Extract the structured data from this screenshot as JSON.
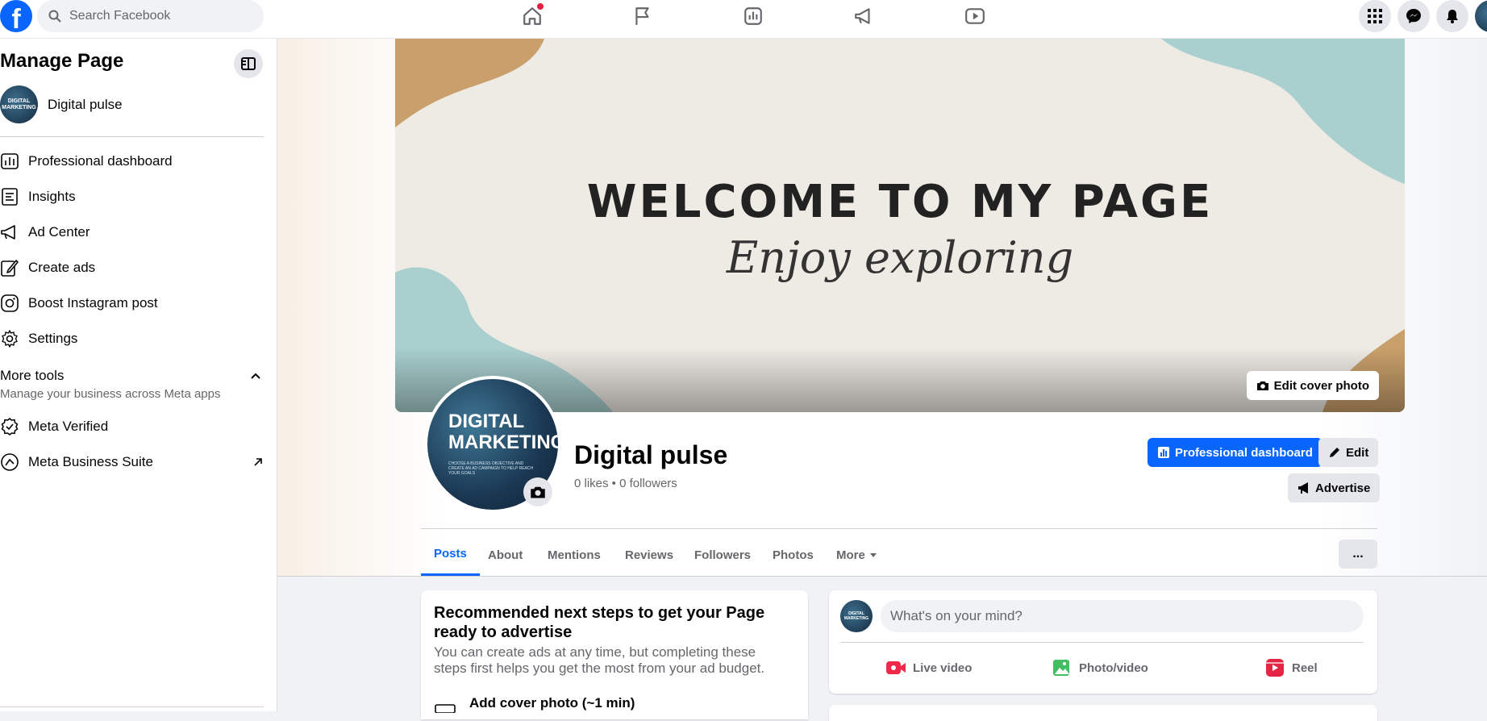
{
  "topbar": {
    "logo": "f",
    "search_placeholder": "Search Facebook",
    "nav": [
      "home-icon",
      "flag-icon",
      "insights-icon",
      "megaphone-icon",
      "video-icon"
    ],
    "right": [
      "menu-grid-icon",
      "messenger-icon",
      "bell-icon"
    ],
    "notification_dot_color": "#e41e3f"
  },
  "sidebar": {
    "title": "Manage Page",
    "page_name": "Digital pulse",
    "page_avatar_text": "DIGITAL MARKETING",
    "items": [
      {
        "label": "Professional dashboard",
        "icon": "dashboard-icon"
      },
      {
        "label": "Insights",
        "icon": "insights-icon"
      },
      {
        "label": "Ad Center",
        "icon": "megaphone-icon"
      },
      {
        "label": "Create ads",
        "icon": "pencil-icon"
      },
      {
        "label": "Boost Instagram post",
        "icon": "instagram-icon"
      },
      {
        "label": "Settings",
        "icon": "gear-icon"
      }
    ],
    "more_tools_title": "More tools",
    "more_tools_sub": "Manage your business across Meta apps",
    "tools": [
      {
        "label": "Meta Verified",
        "icon": "verified-badge-icon"
      },
      {
        "label": "Meta Business Suite",
        "icon": "meta-business-suite-icon"
      }
    ]
  },
  "cover": {
    "headline": "WELCOME TO MY PAGE",
    "script": "Enjoy exploring",
    "edit_label": "Edit cover photo"
  },
  "page": {
    "avatar_line1": "DIGITAL",
    "avatar_line2": "MARKETING",
    "avatar_small": "CHOOSE A BUSINESS OBJECTIVE AND CREATE AN AD CAMPAIGN TO HELP REACH YOUR GOALS",
    "name": "Digital pulse",
    "stats": "0 likes • 0 followers",
    "btn_dashboard": "Professional dashboard",
    "btn_edit": "Edit",
    "btn_advertise": "Advertise",
    "accent": "#0866ff"
  },
  "tabs": [
    "Posts",
    "About",
    "Mentions",
    "Reviews",
    "Followers",
    "Photos",
    "More"
  ],
  "tabs_more_btn": "...",
  "recommend": {
    "title": "Recommended next steps to get your Page ready to advertise",
    "body": "You can create ads at any time, but completing these steps first helps you get the most from your ad budget.",
    "step1": "Add cover photo (~1 min)"
  },
  "composer": {
    "placeholder": "What's on your mind?",
    "avatar_text": "DIGITAL MARKETING",
    "actions": [
      {
        "label": "Live video",
        "icon": "live-video-icon",
        "color": "#f02849"
      },
      {
        "label": "Photo/video",
        "icon": "photo-icon",
        "color": "#45bd62"
      },
      {
        "label": "Reel",
        "icon": "reel-icon",
        "color": "#e42645"
      }
    ]
  }
}
